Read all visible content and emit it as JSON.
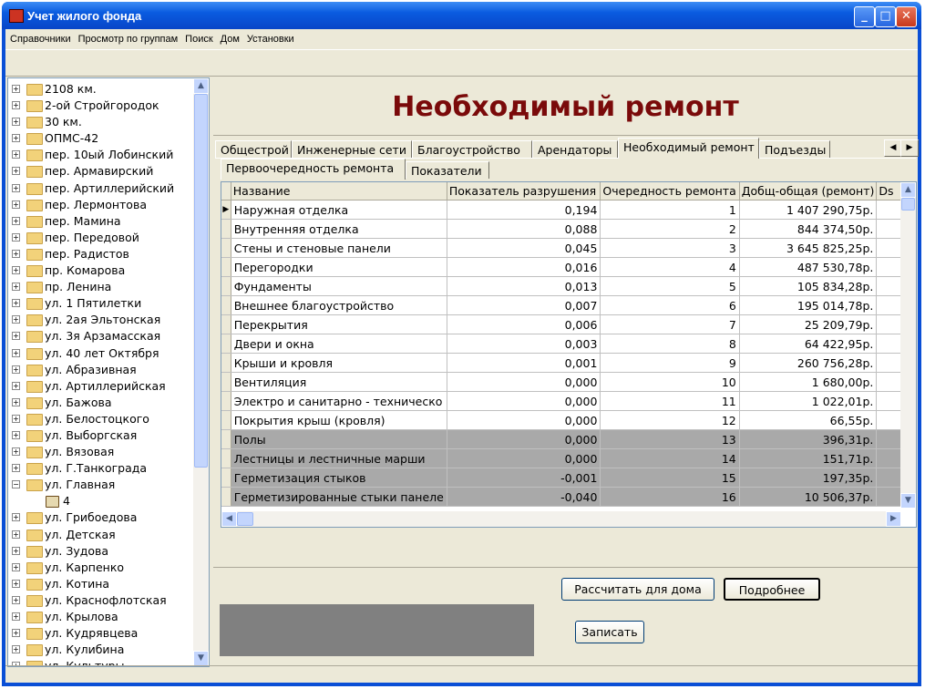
{
  "window": {
    "title": "Учет жилого фонда"
  },
  "menu": [
    "Справочники",
    "Просмотр по группам",
    "Поиск",
    "Дом",
    "Установки"
  ],
  "tree": {
    "items": [
      {
        "label": "2108 км.",
        "expanded": false
      },
      {
        "label": "2-ой Стройгородок",
        "expanded": false
      },
      {
        "label": "30 км.",
        "expanded": false
      },
      {
        "label": "ОПМС-42",
        "expanded": false
      },
      {
        "label": "пер. 10ый Лобинский",
        "expanded": false
      },
      {
        "label": "пер. Армавирский",
        "expanded": false
      },
      {
        "label": "пер. Артиллерийский",
        "expanded": false
      },
      {
        "label": "пер. Лермонтова",
        "expanded": false
      },
      {
        "label": "пер. Мамина",
        "expanded": false
      },
      {
        "label": "пер. Передовой",
        "expanded": false
      },
      {
        "label": "пер. Радистов",
        "expanded": false
      },
      {
        "label": "пр. Комарова",
        "expanded": false
      },
      {
        "label": "пр. Ленина",
        "expanded": false
      },
      {
        "label": "ул. 1 Пятилетки",
        "expanded": false
      },
      {
        "label": "ул. 2ая Эльтонская",
        "expanded": false
      },
      {
        "label": "ул. 3я Арзамасская",
        "expanded": false
      },
      {
        "label": "ул. 40 лет Октября",
        "expanded": false
      },
      {
        "label": "ул. Абразивная",
        "expanded": false
      },
      {
        "label": "ул. Артиллерийская",
        "expanded": false
      },
      {
        "label": "ул. Бажова",
        "expanded": false
      },
      {
        "label": "ул. Белостоцкого",
        "expanded": false
      },
      {
        "label": "ул. Выборгская",
        "expanded": false
      },
      {
        "label": "ул. Вязовая",
        "expanded": false
      },
      {
        "label": "ул. Г.Танкограда",
        "expanded": false
      },
      {
        "label": "ул. Главная",
        "expanded": true
      },
      {
        "label": "4",
        "child": true
      },
      {
        "label": "ул. Грибоедова",
        "expanded": false
      },
      {
        "label": "ул. Детская",
        "expanded": false
      },
      {
        "label": "ул. Зудова",
        "expanded": false
      },
      {
        "label": "ул. Карпенко",
        "expanded": false
      },
      {
        "label": "ул. Котина",
        "expanded": false
      },
      {
        "label": "ул. Краснофлотская",
        "expanded": false
      },
      {
        "label": "ул. Крылова",
        "expanded": false
      },
      {
        "label": "ул. Кудрявцева",
        "expanded": false
      },
      {
        "label": "ул. Кулибина",
        "expanded": false
      },
      {
        "label": "ул. Культуры",
        "expanded": false
      }
    ]
  },
  "heading": "Необходимый ремонт",
  "tabs": [
    "Общестрой",
    "Инженерные сети",
    "Благоустройство",
    "Арендаторы",
    "Необходимый ремонт",
    "Подъезды"
  ],
  "active_tab": "Необходимый ремонт",
  "subtabs": [
    "Первоочередность ремонта",
    "Показатели"
  ],
  "active_subtab": "Первоочередность ремонта",
  "table": {
    "columns": [
      "Название",
      "Показатель разрушения",
      "Очередность ремонта",
      "Добщ-общая (ремонт)",
      "Ds"
    ],
    "rows": [
      {
        "name": "Наружная отделка",
        "damage": "0,194",
        "order": "1",
        "cost": "1 407 290,75р.",
        "gray": false
      },
      {
        "name": "Внутренняя отделка",
        "damage": "0,088",
        "order": "2",
        "cost": "844 374,50р.",
        "gray": false
      },
      {
        "name": "Стены и стеновые панели",
        "damage": "0,045",
        "order": "3",
        "cost": "3 645 825,25р.",
        "gray": false
      },
      {
        "name": "Перегородки",
        "damage": "0,016",
        "order": "4",
        "cost": "487 530,78р.",
        "gray": false
      },
      {
        "name": "Фундаменты",
        "damage": "0,013",
        "order": "5",
        "cost": "105 834,28р.",
        "gray": false
      },
      {
        "name": "Внешнее благоустройство",
        "damage": "0,007",
        "order": "6",
        "cost": "195 014,78р.",
        "gray": false
      },
      {
        "name": "Перекрытия",
        "damage": "0,006",
        "order": "7",
        "cost": "25 209,79р.",
        "gray": false
      },
      {
        "name": "Двери и окна",
        "damage": "0,003",
        "order": "8",
        "cost": "64 422,95р.",
        "gray": false
      },
      {
        "name": "Крыши и кровля",
        "damage": "0,001",
        "order": "9",
        "cost": "260 756,28р.",
        "gray": false
      },
      {
        "name": "Вентиляция",
        "damage": "0,000",
        "order": "10",
        "cost": "1 680,00р.",
        "gray": false
      },
      {
        "name": "Электро и санитарно - техническо",
        "damage": "0,000",
        "order": "11",
        "cost": "1 022,01р.",
        "gray": false
      },
      {
        "name": "Покрытия крыш (кровля)",
        "damage": "0,000",
        "order": "12",
        "cost": "66,55р.",
        "gray": false
      },
      {
        "name": "Полы",
        "damage": "0,000",
        "order": "13",
        "cost": "396,31р.",
        "gray": true
      },
      {
        "name": "Лестницы и лестничные марши",
        "damage": "0,000",
        "order": "14",
        "cost": "151,71р.",
        "gray": true
      },
      {
        "name": "Герметизация стыков",
        "damage": "-0,001",
        "order": "15",
        "cost": "197,35р.",
        "gray": true
      },
      {
        "name": "Герметизированные стыки панеле",
        "damage": "-0,040",
        "order": "16",
        "cost": "10 506,37р.",
        "gray": true
      }
    ]
  },
  "buttons": {
    "calculate": "Рассчитать для дома",
    "details": "Подробнее",
    "save": "Записать"
  },
  "colors": {
    "heading": "#7a0a0a",
    "titlebar": "#0a5be0",
    "gray_rows": "#a9a9a9"
  }
}
